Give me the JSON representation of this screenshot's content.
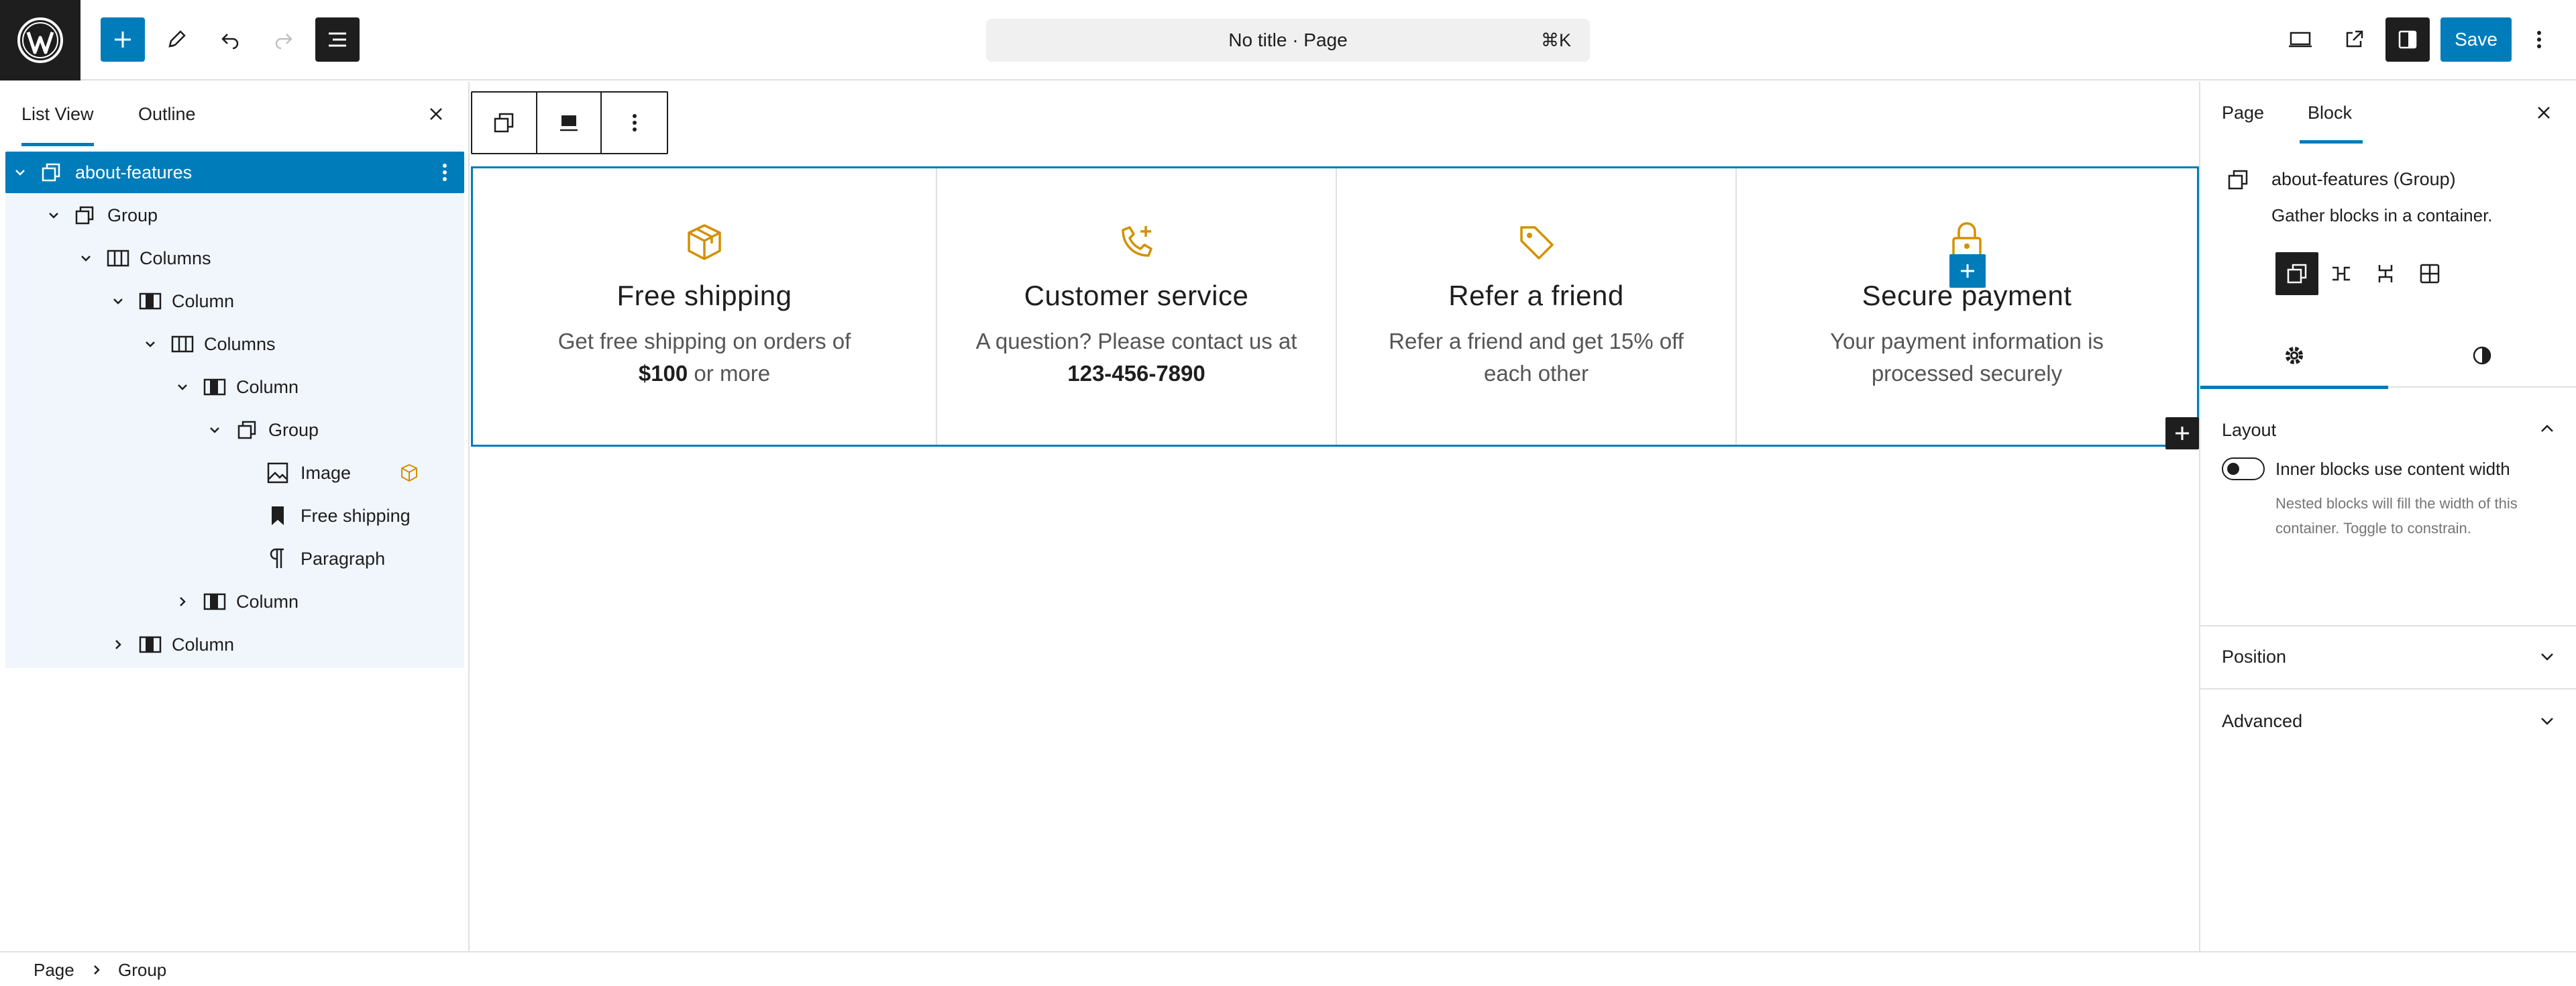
{
  "header": {
    "logo_icon": "wordpress-logo-icon",
    "command_bar": {
      "title": "No title · Page",
      "shortcut": "⌘K"
    },
    "save_label": "Save",
    "accent": "#007cba"
  },
  "left_panel": {
    "tabs": [
      {
        "label": "List View",
        "active": true
      },
      {
        "label": "Outline",
        "active": false
      }
    ],
    "tree": [
      {
        "label": "about-features",
        "icon": "group-icon",
        "expanded": true,
        "selected": true
      },
      {
        "label": "Group",
        "icon": "group-icon",
        "expanded": true
      },
      {
        "label": "Columns",
        "icon": "columns-icon",
        "expanded": true
      },
      {
        "label": "Column",
        "icon": "column-icon",
        "expanded": true
      },
      {
        "label": "Columns",
        "icon": "columns-icon",
        "expanded": true
      },
      {
        "label": "Column",
        "icon": "column-icon",
        "expanded": true
      },
      {
        "label": "Group",
        "icon": "group-icon",
        "expanded": true
      },
      {
        "label": "Image",
        "icon": "image-icon"
      },
      {
        "label": "Free shipping",
        "icon": "heading-icon"
      },
      {
        "label": "Paragraph",
        "icon": "paragraph-icon"
      },
      {
        "label": "Column",
        "icon": "column-icon",
        "expanded": false
      },
      {
        "label": "Column",
        "icon": "column-icon",
        "expanded": false
      }
    ]
  },
  "canvas": {
    "features": [
      {
        "icon": "box-icon",
        "title": "Free shipping",
        "text_before": "Get free shipping on orders of",
        "text_bold": "$100",
        "text_after": " or more"
      },
      {
        "icon": "phone-plus-icon",
        "title": "Customer service",
        "text_before": "A question? Please contact us at",
        "text_bold": "123-456-7890",
        "text_after": ""
      },
      {
        "icon": "tag-icon",
        "title": "Refer a friend",
        "text_before": "Refer a friend and get 15% off",
        "text_bold": "",
        "text_after": "each other"
      },
      {
        "icon": "lock-icon",
        "title": "Secure payment",
        "text_before": "Your payment information is",
        "text_bold": "",
        "text_after": "processed securely"
      }
    ],
    "icon_color": "#d39000"
  },
  "right_panel": {
    "tabs": [
      {
        "label": "Page",
        "active": false
      },
      {
        "label": "Block",
        "active": true
      }
    ],
    "block_card": {
      "title": "about-features (Group)",
      "description": "Gather blocks in a container."
    },
    "sections": {
      "layout": "Layout",
      "toggle_label": "Inner blocks use content width",
      "toggle_on": false,
      "help": "Nested blocks will fill the width of this container. Toggle to constrain.",
      "position": "Position",
      "advanced": "Advanced"
    }
  },
  "footer": {
    "breadcrumbs": [
      "Page",
      "Group"
    ]
  }
}
